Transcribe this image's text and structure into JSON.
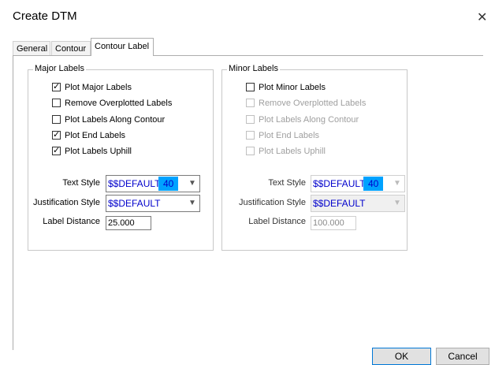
{
  "window": {
    "title": "Create DTM",
    "close_glyph": "✕"
  },
  "tabs": [
    {
      "label": "General"
    },
    {
      "label": "Contour"
    },
    {
      "label": "Contour Label"
    }
  ],
  "major": {
    "title": "Major Labels",
    "options": [
      {
        "label": "Plot Major Labels",
        "checked": true
      },
      {
        "label": "Remove Overplotted Labels",
        "checked": false
      },
      {
        "label": "Plot Labels Along Contour",
        "checked": false
      },
      {
        "label": "Plot End Labels",
        "checked": true
      },
      {
        "label": "Plot Labels Uphill",
        "checked": true
      }
    ],
    "text_style_label": "Text Style",
    "text_style_value": "$$DEFAULT",
    "text_style_number": "40",
    "justification_label": "Justification Style",
    "justification_value": "$$DEFAULT",
    "distance_label": "Label Distance",
    "distance_value": "25.000"
  },
  "minor": {
    "title": "Minor Labels",
    "options": [
      {
        "label": "Plot Minor Labels",
        "checked": false
      },
      {
        "label": "Remove Overplotted Labels",
        "checked": false
      },
      {
        "label": "Plot Labels Along Contour",
        "checked": false
      },
      {
        "label": "Plot End Labels",
        "checked": false
      },
      {
        "label": "Plot Labels Uphill",
        "checked": false
      }
    ],
    "text_style_label": "Text Style",
    "text_style_value": "$$DEFAULT",
    "text_style_number": "40",
    "justification_label": "Justification Style",
    "justification_value": "$$DEFAULT",
    "distance_label": "Label Distance",
    "distance_value": "100.000"
  },
  "buttons": {
    "ok": "OK",
    "cancel": "Cancel"
  },
  "icons": {
    "check": "checkmark-icon",
    "dropdown": "chevron-down-icon",
    "close": "close-icon"
  },
  "colors": {
    "highlight": "#00a2ff",
    "value_text": "#0000cc"
  }
}
